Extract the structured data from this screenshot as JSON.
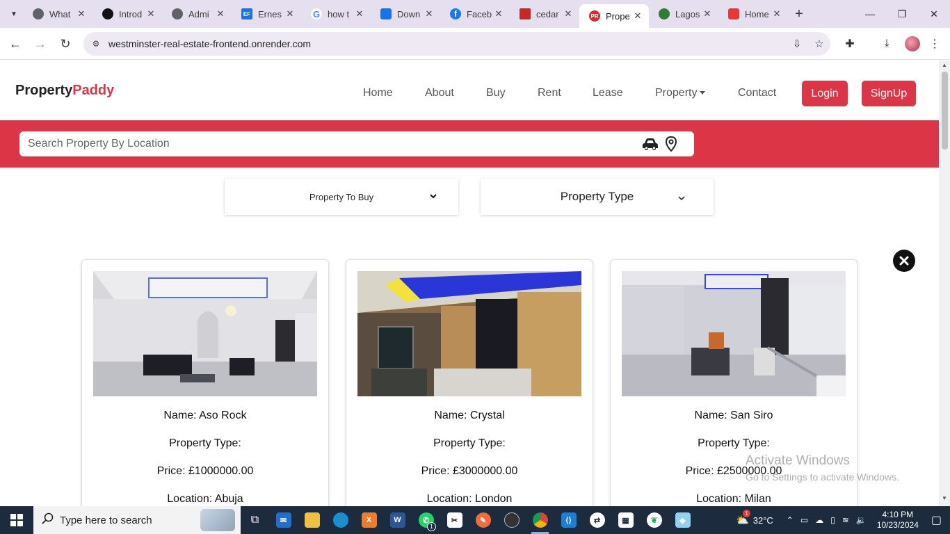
{
  "browser": {
    "tabs": [
      {
        "title": "What",
        "fav_color": "#5f6368",
        "active": false
      },
      {
        "title": "Introd",
        "fav_color": "#111111",
        "active": false
      },
      {
        "title": "Admi",
        "fav_color": "#5f6368",
        "active": false
      },
      {
        "title": "Ernes",
        "fav_color": "#1a73e8",
        "fav_text": "EF",
        "active": false
      },
      {
        "title": "how t",
        "fav_color": "#4285f4",
        "fav_text": "G",
        "active": false
      },
      {
        "title": "Down",
        "fav_color": "#1a73e8",
        "active": false
      },
      {
        "title": "Faceb",
        "fav_color": "#1877f2",
        "fav_text": "f",
        "active": false
      },
      {
        "title": "cedar",
        "fav_color": "#c62828",
        "active": false
      },
      {
        "title": "Prope",
        "fav_color": "#d32f2f",
        "fav_text": "PR",
        "active": true
      },
      {
        "title": "Lagos",
        "fav_color": "#2e7d32",
        "active": false
      },
      {
        "title": "Home",
        "fav_color": "#e53935",
        "active": false
      }
    ],
    "url": "westminster-real-estate-frontend.onrender.com"
  },
  "site": {
    "brand_main": "Property",
    "brand_accent": "Paddy",
    "nav": [
      "Home",
      "About",
      "Buy",
      "Rent",
      "Lease",
      "Property",
      "Contact"
    ],
    "login_label": "Login",
    "signup_label": "SignUp",
    "search_placeholder": "Search Property By Location",
    "filter_buy": "Property To Buy",
    "filter_type": "Property Type",
    "accent_color": "#dc3545"
  },
  "cards": [
    {
      "name": "Name: Aso Rock",
      "type": "Property Type:",
      "price": "Price: £1000000.00",
      "location": "Location: Abuja"
    },
    {
      "name": "Name: Crystal",
      "type": "Property Type:",
      "price": "Price: £3000000.00",
      "location": "Location: London"
    },
    {
      "name": "Name: San Siro",
      "type": "Property Type:",
      "price": "Price: £2500000.00",
      "location": "Location: Milan"
    }
  ],
  "watermark": {
    "line1": "Activate Windows",
    "line2": "Go to Settings to activate Windows."
  },
  "taskbar": {
    "search_placeholder": "Type here to search",
    "temperature": "32°C",
    "time": "4:10 PM",
    "date": "10/23/2024",
    "whatsapp_badge": "1",
    "weather_badge": "1"
  }
}
